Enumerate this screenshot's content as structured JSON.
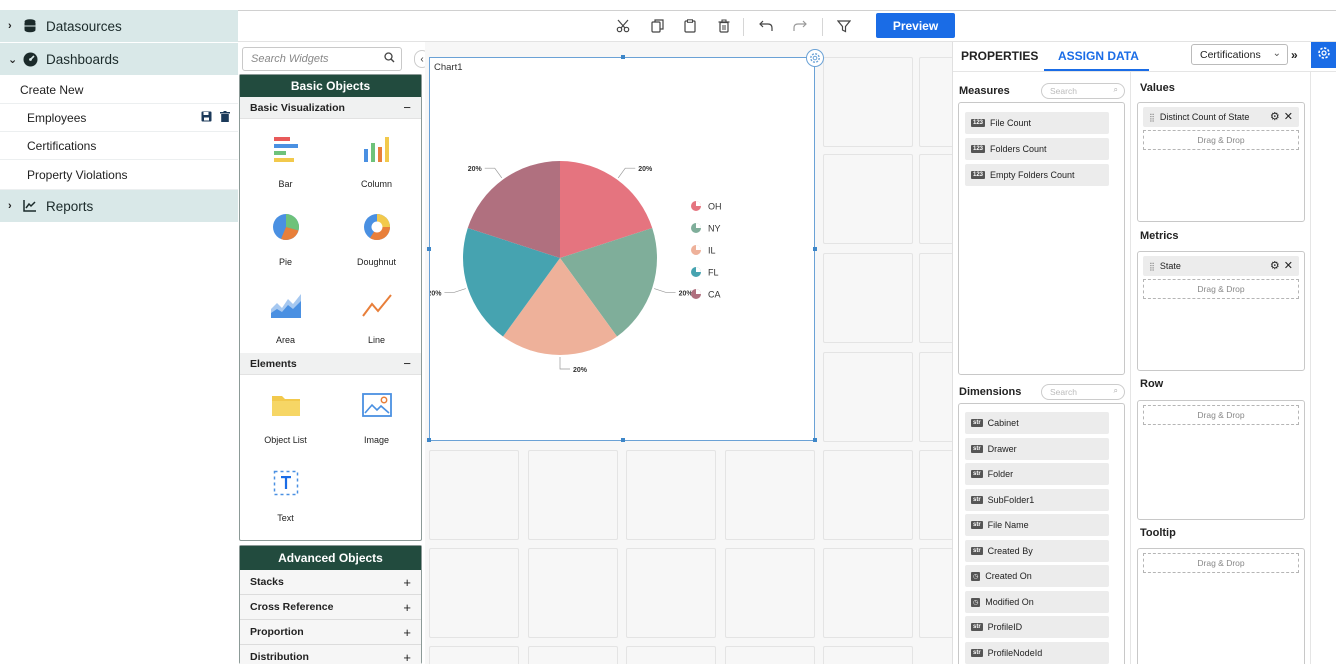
{
  "nav": {
    "datasources_label": "Datasources",
    "dashboards_label": "Dashboards",
    "create_new_label": "Create New",
    "items": [
      {
        "label": "Employees"
      },
      {
        "label": "Certifications"
      },
      {
        "label": "Property Violations"
      }
    ],
    "reports_label": "Reports"
  },
  "toolbar": {
    "preview_label": "Preview",
    "icons": [
      "cut-icon",
      "copy-icon",
      "paste-icon",
      "delete-icon",
      "undo-icon",
      "redo-icon",
      "filter-icon"
    ]
  },
  "widgets": {
    "search_placeholder": "Search Widgets",
    "basic_title": "Basic Objects",
    "basic_viz_section": "Basic Visualization",
    "basic_items": [
      {
        "label": "Bar",
        "icon": "bar-chart-icon"
      },
      {
        "label": "Column",
        "icon": "column-chart-icon"
      },
      {
        "label": "Pie",
        "icon": "pie-chart-icon"
      },
      {
        "label": "Doughnut",
        "icon": "doughnut-chart-icon"
      },
      {
        "label": "Area",
        "icon": "area-chart-icon"
      },
      {
        "label": "Line",
        "icon": "line-chart-icon"
      }
    ],
    "elements_section": "Elements",
    "element_items": [
      {
        "label": "Object List",
        "icon": "folder-icon"
      },
      {
        "label": "Image",
        "icon": "image-icon"
      },
      {
        "label": "Text",
        "icon": "text-icon"
      }
    ],
    "advanced_title": "Advanced Objects",
    "advanced_items": [
      "Stacks",
      "Cross Reference",
      "Proportion",
      "Distribution"
    ]
  },
  "chart_widget": {
    "title": "Chart1"
  },
  "chart_data": {
    "type": "pie",
    "categories": [
      "OH",
      "NY",
      "IL",
      "FL",
      "CA"
    ],
    "values": [
      20,
      20,
      20,
      20,
      20
    ],
    "data_labels": [
      "20%",
      "20%",
      "20%",
      "20%",
      "20%"
    ],
    "colors": [
      "#e5747f",
      "#7fae9a",
      "#eeb19a",
      "#46a3b0",
      "#b0707f"
    ],
    "legend_position": "right"
  },
  "properties": {
    "tab_properties": "PROPERTIES",
    "tab_assign_data": "ASSIGN DATA",
    "datasource_selected": "Certifications",
    "measures_label": "Measures",
    "measures_search_placeholder": "Search",
    "measures": [
      "File Count",
      "Folders Count",
      "Empty Folders Count"
    ],
    "dimensions_label": "Dimensions",
    "dimensions_search_placeholder": "Search",
    "dimensions": [
      {
        "label": "Cabinet",
        "type": "str"
      },
      {
        "label": "Drawer",
        "type": "str"
      },
      {
        "label": "Folder",
        "type": "str"
      },
      {
        "label": "SubFolder1",
        "type": "str"
      },
      {
        "label": "File Name",
        "type": "str"
      },
      {
        "label": "Created By",
        "type": "str"
      },
      {
        "label": "Created On",
        "type": "date"
      },
      {
        "label": "Modified On",
        "type": "date"
      },
      {
        "label": "ProfileID",
        "type": "str"
      },
      {
        "label": "ProfileNodeId",
        "type": "str"
      }
    ],
    "values_label": "Values",
    "values_item": "Distinct Count of State",
    "metrics_label": "Metrics",
    "metrics_item": "State",
    "row_label": "Row",
    "tooltip_label": "Tooltip",
    "drop_hint": "Drag & Drop"
  }
}
